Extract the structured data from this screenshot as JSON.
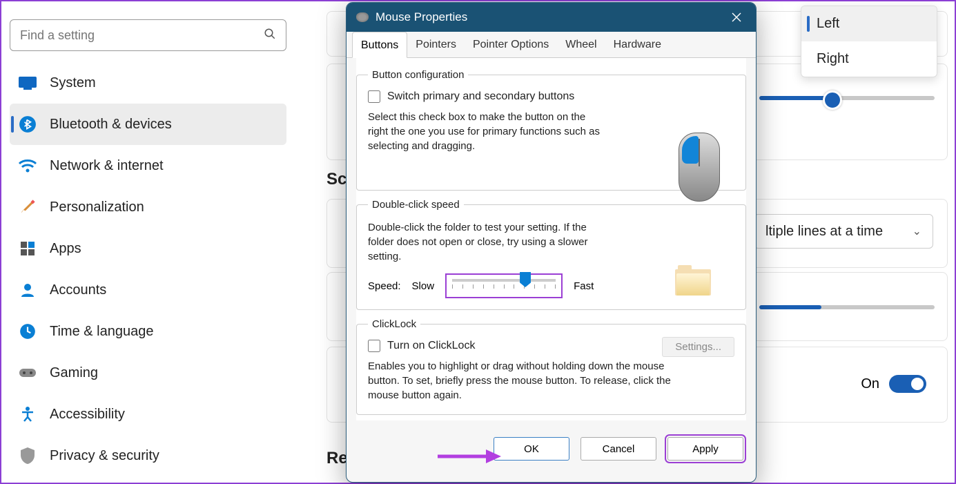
{
  "search": {
    "placeholder": "Find a setting"
  },
  "sidebar": {
    "items": [
      {
        "label": "System"
      },
      {
        "label": "Bluetooth & devices"
      },
      {
        "label": "Network & internet"
      },
      {
        "label": "Personalization"
      },
      {
        "label": "Apps"
      },
      {
        "label": "Accounts"
      },
      {
        "label": "Time & language"
      },
      {
        "label": "Gaming"
      },
      {
        "label": "Accessibility"
      },
      {
        "label": "Privacy & security"
      }
    ],
    "active_index": 1
  },
  "background": {
    "section_scrolling_fragment": "Scr",
    "section_related_fragment": "Re",
    "dropdown_visible_text": "ltiple lines at a time",
    "toggle_label": "On",
    "primary_button_popup": {
      "options": [
        "Left",
        "Right"
      ],
      "selected_index": 0
    }
  },
  "dialog": {
    "title": "Mouse Properties",
    "tabs": [
      "Buttons",
      "Pointers",
      "Pointer Options",
      "Wheel",
      "Hardware"
    ],
    "active_tab_index": 0,
    "button_config": {
      "legend": "Button configuration",
      "checkbox_label": "Switch primary and secondary buttons",
      "checkbox_checked": false,
      "description": "Select this check box to make the button on the right the one you use for primary functions such as selecting and dragging."
    },
    "double_click": {
      "legend": "Double-click speed",
      "description": "Double-click the folder to test your setting. If the folder does not open or close, try using a slower setting.",
      "speed_label": "Speed:",
      "slow_label": "Slow",
      "fast_label": "Fast",
      "slider_value_pct": 65
    },
    "clicklock": {
      "legend": "ClickLock",
      "checkbox_label": "Turn on ClickLock",
      "checkbox_checked": false,
      "settings_button": "Settings...",
      "settings_enabled": false,
      "description": "Enables you to highlight or drag without holding down the mouse button. To set, briefly press the mouse button. To release, click the mouse button again."
    },
    "buttons": {
      "ok": "OK",
      "cancel": "Cancel",
      "apply": "Apply"
    }
  }
}
